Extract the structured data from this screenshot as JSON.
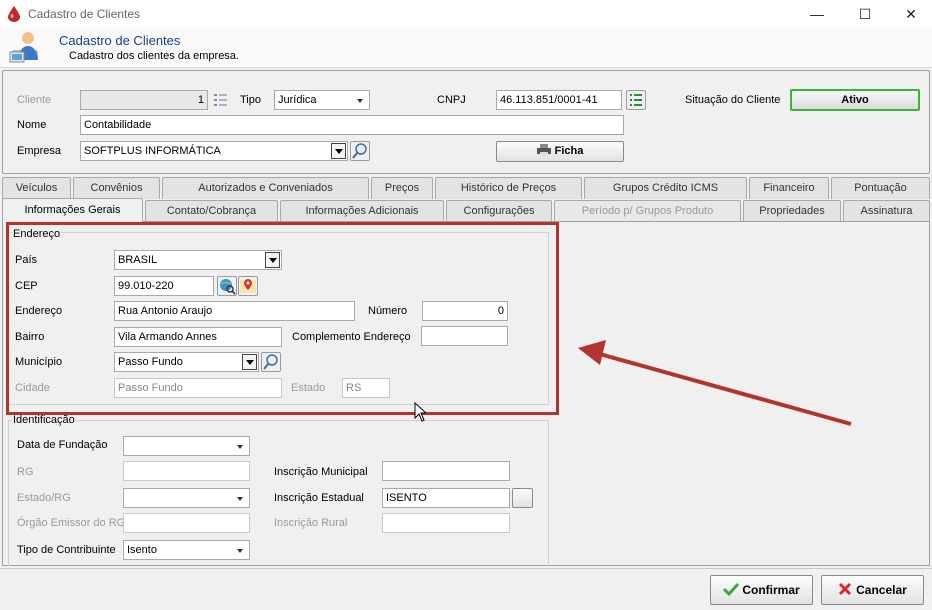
{
  "window": {
    "title": "Cadastro de Clientes",
    "controls": {
      "minimize": "—",
      "maximize": "☐",
      "close": "✕"
    }
  },
  "header": {
    "title": "Cadastro de Clientes",
    "subtitle": "Cadastro dos clientes da empresa."
  },
  "top_form": {
    "cliente_label": "Cliente",
    "cliente_value": "1",
    "tipo_label": "Tipo",
    "tipo_value": "Jurídica",
    "cnpj_label": "CNPJ",
    "cnpj_value": "46.113.851/0001-41",
    "situacao_label": "Situação do Cliente",
    "situacao_value": "Ativo",
    "nome_label": "Nome",
    "nome_value": "Contabilidade",
    "empresa_label": "Empresa",
    "empresa_value": "SOFTPLUS INFORMÁTICA",
    "ficha_label": "Ficha"
  },
  "tabs_row1": [
    "Veículos",
    "Convênios",
    "Autorizados e Conveniados",
    "Preços",
    "Histórico de Preços",
    "Grupos Crédito ICMS",
    "Financeiro",
    "Pontuação"
  ],
  "tabs_row2": [
    "Informações Gerais",
    "Contato/Cobrança",
    "Informações Adicionais",
    "Configurações",
    "Período p/ Grupos Produto",
    "Propriedades",
    "Assinatura"
  ],
  "endereco": {
    "group_label": "Endereço",
    "pais_label": "País",
    "pais_value": "BRASIL",
    "cep_label": "CEP",
    "cep_value": "99.010-220",
    "endereco_label": "Endereço",
    "endereco_value": "Rua Antonio Araujo",
    "numero_label": "Número",
    "numero_value": "0",
    "bairro_label": "Bairro",
    "bairro_value": "Vila Armando Annes",
    "complemento_label": "Complemento Endereço",
    "complemento_value": "",
    "municipio_label": "Município",
    "municipio_value": "Passo Fundo",
    "cidade_label": "Cidade",
    "cidade_value": "Passo Fundo",
    "estado_label": "Estado",
    "estado_value": "RS"
  },
  "identificacao": {
    "group_label": "Identificação",
    "data_fundacao_label": "Data de Fundação",
    "data_fundacao_value": "",
    "rg_label": "RG",
    "rg_value": "",
    "estado_rg_label": "Estado/RG",
    "estado_rg_value": "",
    "orgao_label": "Órgão Emissor do RG",
    "orgao_value": "",
    "tipo_contribuinte_label": "Tipo de Contribuinte",
    "tipo_contribuinte_value": "Isento",
    "insc_municipal_label": "Inscrição Municipal",
    "insc_municipal_value": "",
    "insc_estadual_label": "Inscrição Estadual",
    "insc_estadual_value": "ISENTO",
    "insc_rural_label": "Inscrição Rural",
    "insc_rural_value": ""
  },
  "footer": {
    "confirmar_label": "Confirmar",
    "cancelar_label": "Cancelar"
  },
  "colors": {
    "annotation": "#b5332e",
    "header_title": "#1b3f8b",
    "ativo_border": "#3cb43c"
  }
}
